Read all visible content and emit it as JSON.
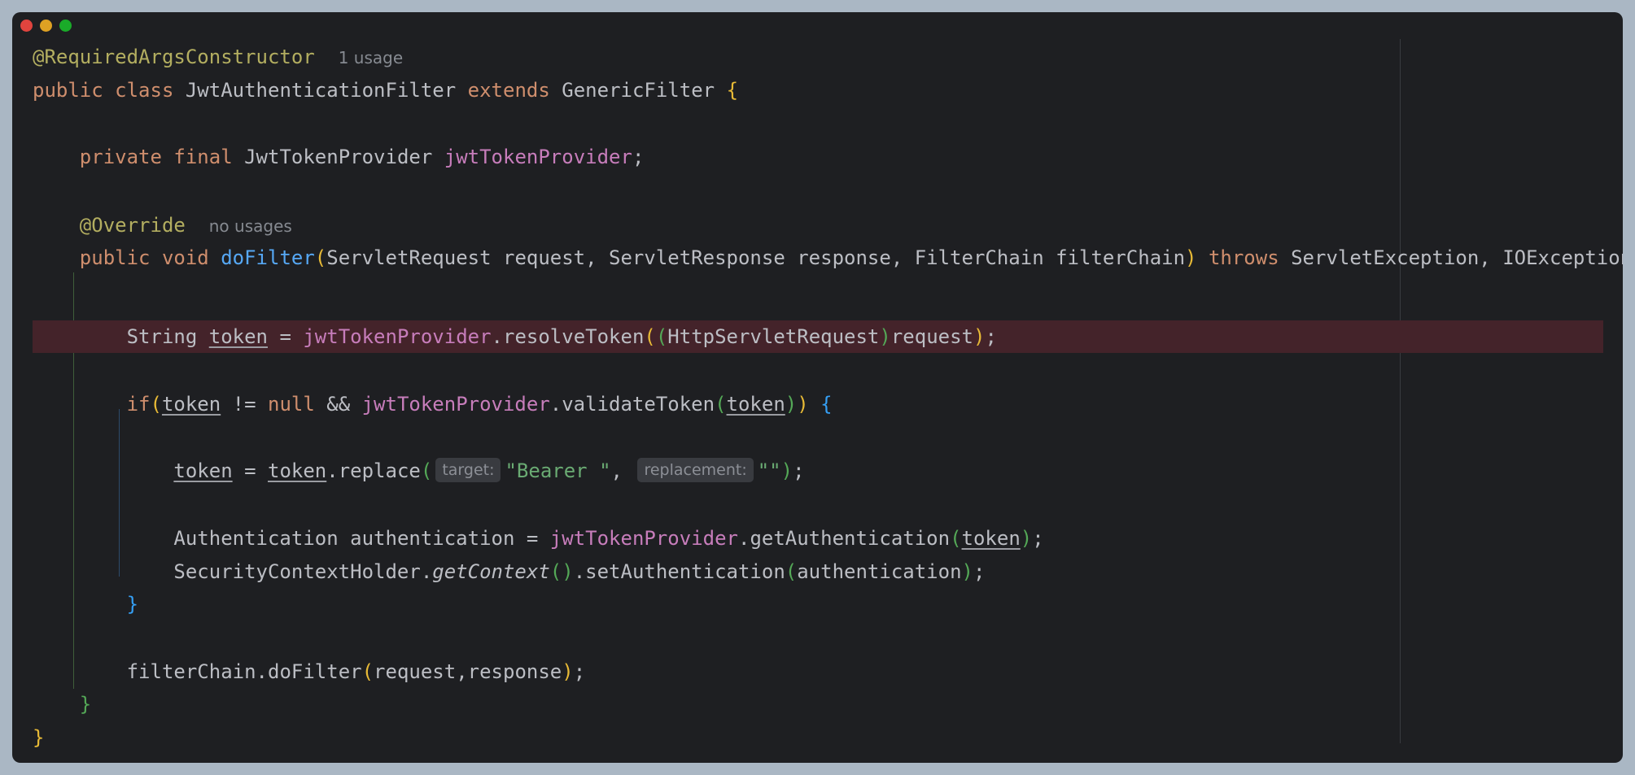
{
  "window": {
    "controls": [
      "close",
      "minimize",
      "zoom"
    ]
  },
  "code": {
    "annotation_class": "@RequiredArgsConstructor",
    "usage_hint_class": "1 usage",
    "kw_public": "public",
    "kw_class": "class",
    "class_name": "JwtAuthenticationFilter",
    "kw_extends": "extends",
    "parent_class": "GenericFilter",
    "brace_open": "{",
    "kw_private": "private",
    "kw_final": "final",
    "field_type": "JwtTokenProvider",
    "field_name": "jwtTokenProvider",
    "semicolon": ";",
    "annotation_override": "@Override",
    "usage_hint_method": "no usages",
    "kw_void": "void",
    "method_name": "doFilter",
    "method_params": "ServletRequest request, ServletResponse response, FilterChain filterChain",
    "kw_throws": "throws",
    "method_throws": "ServletException, IOException",
    "type_string": "String",
    "var_token": "token",
    "assign": " = ",
    "dot": ".",
    "call_resolve": "resolveToken",
    "cast_type": "HttpServletRequest",
    "arg_request": "request",
    "kw_if": "if",
    "op_neq": " != ",
    "kw_null": "null",
    "op_and": " && ",
    "call_validate": "validateToken",
    "call_replace": "replace",
    "hint_target": "target:",
    "str_bearer": "\"Bearer \"",
    "comma": ", ",
    "hint_replacement": "replacement:",
    "str_empty": "\"\"",
    "type_auth": "Authentication",
    "var_auth": "authentication",
    "call_getauth": "getAuthentication",
    "holder_class": "SecurityContextHolder",
    "call_getcontext": "getContext",
    "call_setauth": "setAuthentication",
    "var_filterchain": "filterChain",
    "call_dofilter": "doFilter",
    "args_req_resp": "request,response",
    "brace_close": "}",
    "paren_open": "(",
    "paren_close": ")"
  },
  "colors": {
    "background": "#1e1f22",
    "highlight_line": "#44232a",
    "keyword": "#cf8e6d",
    "annotation": "#b3ae60",
    "field": "#c77dbb",
    "method_decl": "#56a8f5",
    "string": "#6aab73"
  }
}
